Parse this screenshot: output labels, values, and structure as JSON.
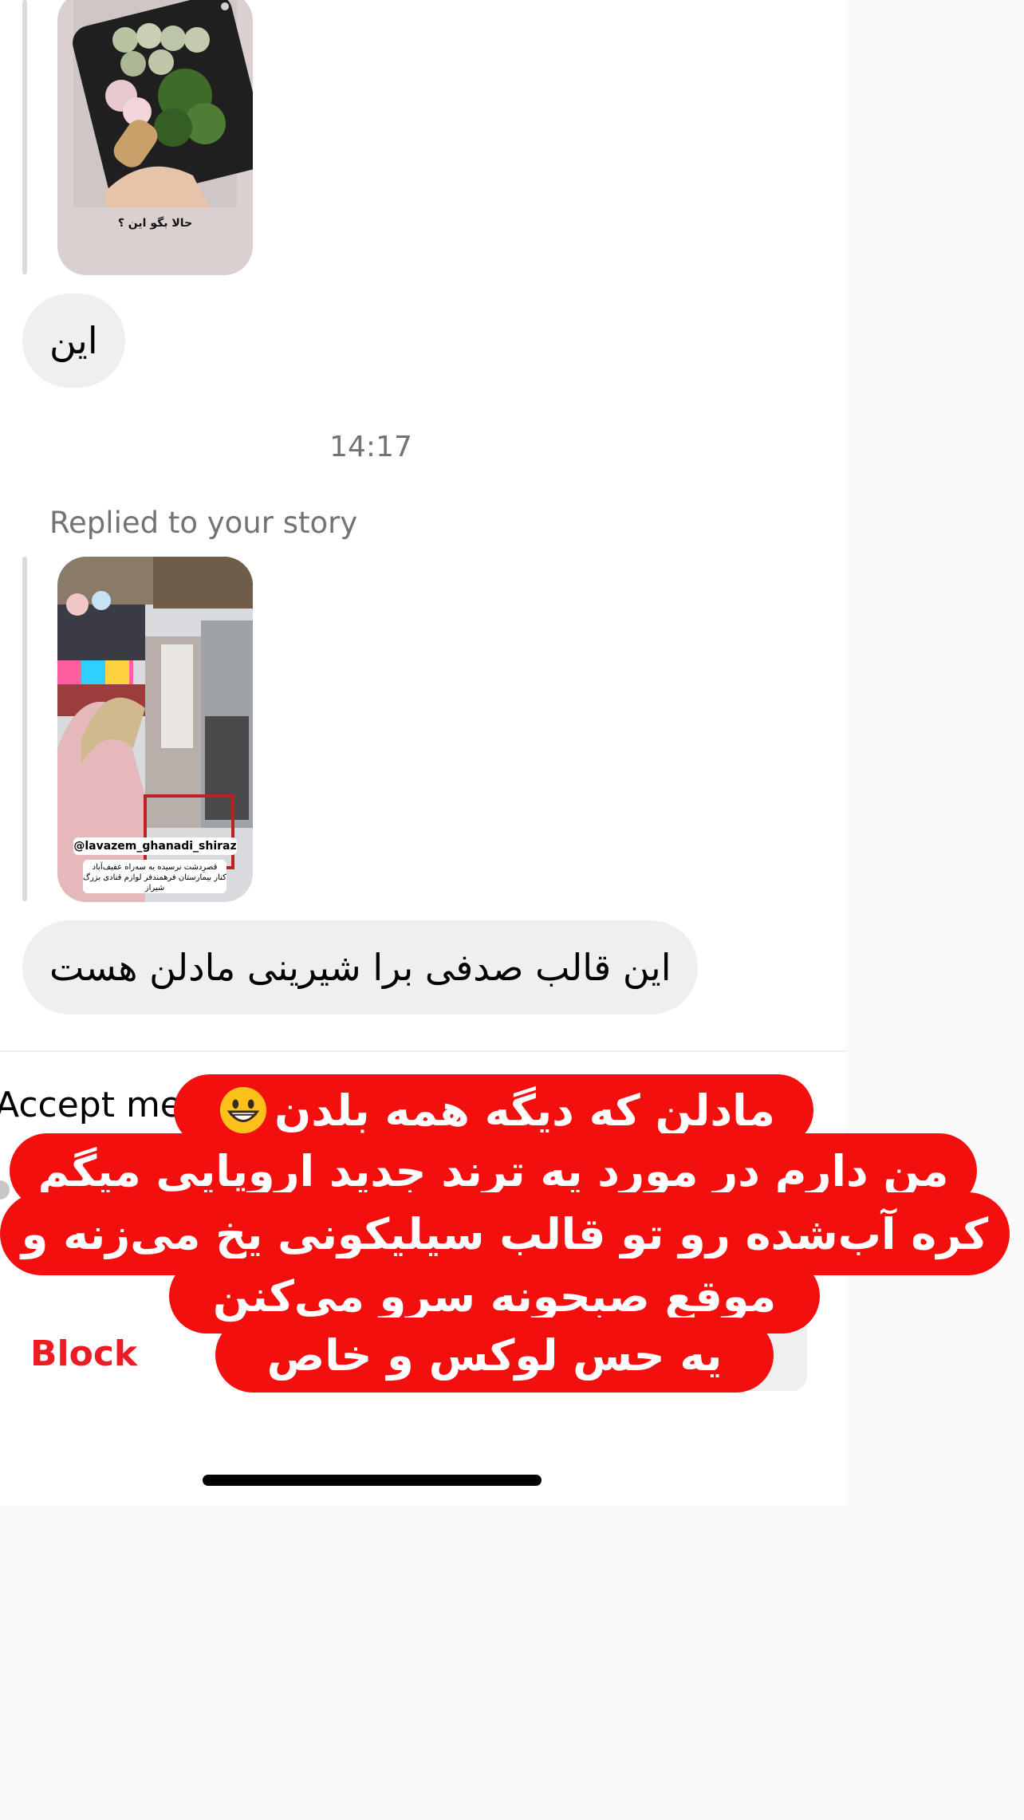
{
  "messages": {
    "story1_caption": "حالا بگو این ؟",
    "bubble_1": "این",
    "timestamp": "14:17",
    "replied_label": "Replied to your story",
    "story2_handle": "@lavazem_ghanadi_shiraz",
    "story2_caption_line1": "قصرِدشت نرسیده به سه‌راه عفیف‌آباد",
    "story2_caption_line2": "کنار بیمارستان فرهمندفر لوازم قنادی بزرگ شیراز",
    "bubble_2": "این قالب صدفی برا شیرینی مادلن هست"
  },
  "request_bar": {
    "accept_text": "Accept mes",
    "block_label": "Block"
  },
  "overlay": {
    "line1": "مادلن که دیگه همه بلدن",
    "line2": "من دارم در مورد یه ترند جدید اروپایی میگم",
    "line3": "کره آب‌شده رو تو قالب سیلیکونی یخ می‌زنه و",
    "line4": "موقع صبحونه سرو می‌کنن",
    "line5": "یه حس لوکس و خاص",
    "emoji": "grinning-face-emoji",
    "background_color": "#f40f0f",
    "text_color": "#ffffff"
  },
  "colors": {
    "bubble_bg": "#efeff1",
    "block_red": "#ed1c24",
    "muted_text": "#737373"
  }
}
